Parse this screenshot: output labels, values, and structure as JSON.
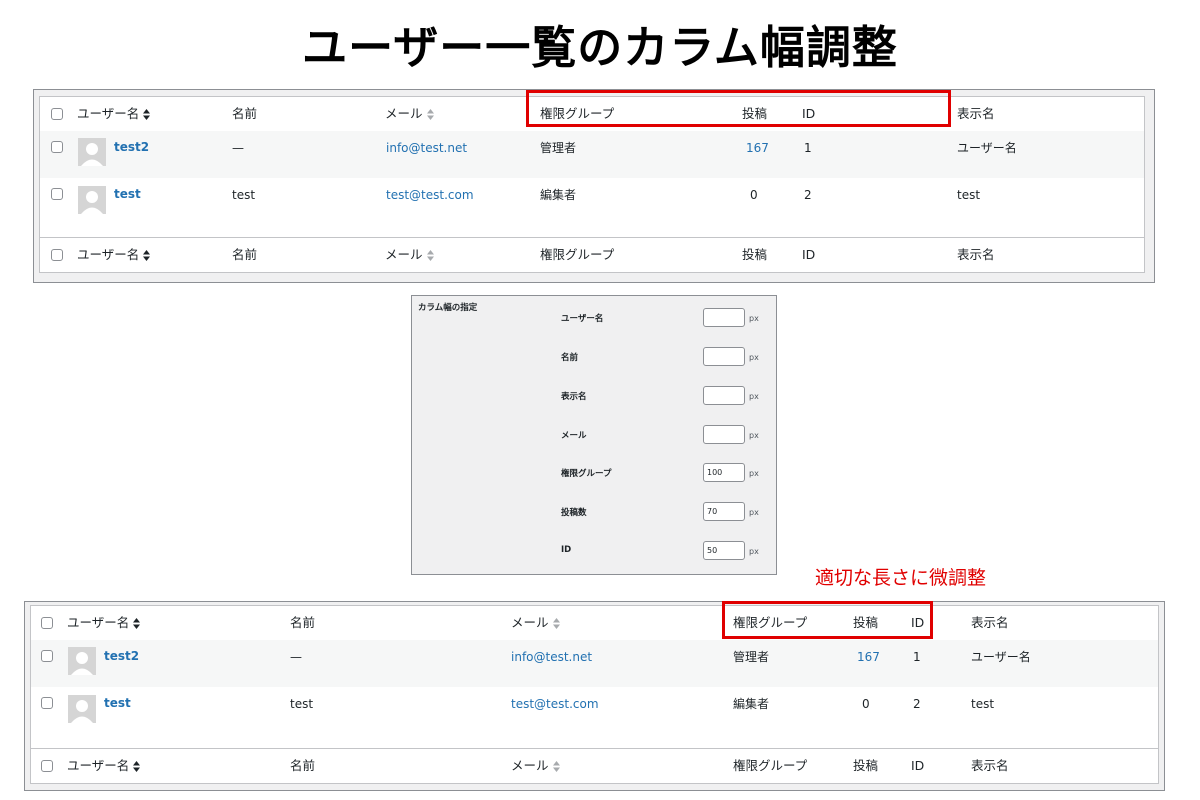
{
  "title": "ユーザー一覧のカラム幅調整",
  "note": "適切な長さに微調整",
  "colors": {
    "link": "#2271b1",
    "highlight": "#e00000",
    "text": "#1d2327"
  },
  "table": {
    "headers": {
      "username": "ユーザー名",
      "name": "名前",
      "email": "メール",
      "role": "権限グループ",
      "posts": "投稿",
      "id": "ID",
      "display_name": "表示名"
    },
    "rows": [
      {
        "username": "test2",
        "name": "—",
        "email": "info@test.net",
        "role": "管理者",
        "posts": "167",
        "id": "1",
        "display_name": "ユーザー名"
      },
      {
        "username": "test",
        "name": "test",
        "email": "test@test.com",
        "role": "編集者",
        "posts": "0",
        "id": "2",
        "display_name": "test"
      }
    ]
  },
  "settings": {
    "title": "カラム幅の指定",
    "unit": "px",
    "fields": [
      {
        "label": "ユーザー名",
        "value": ""
      },
      {
        "label": "名前",
        "value": ""
      },
      {
        "label": "表示名",
        "value": ""
      },
      {
        "label": "メール",
        "value": ""
      },
      {
        "label": "権限グループ",
        "value": "100"
      },
      {
        "label": "投稿数",
        "value": "70"
      },
      {
        "label": "ID",
        "value": "50"
      }
    ]
  }
}
